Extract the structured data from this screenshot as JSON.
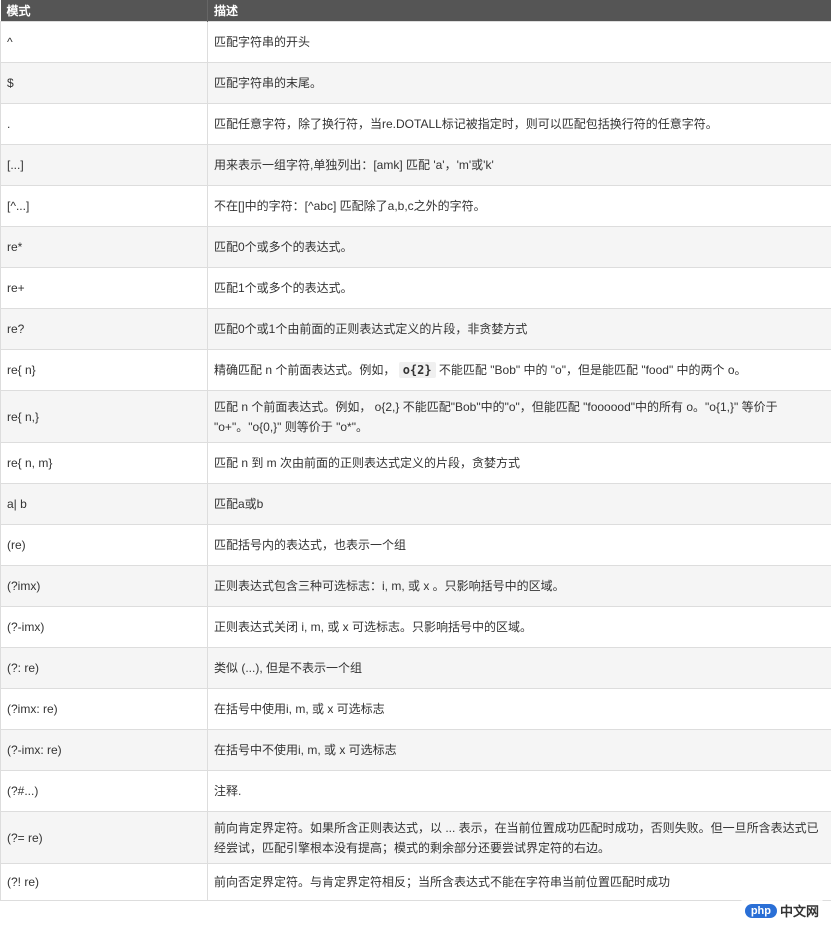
{
  "table": {
    "headers": [
      "模式",
      "描述"
    ],
    "rows": [
      {
        "pattern": "^",
        "desc": "匹配字符串的开头"
      },
      {
        "pattern": "$",
        "desc": "匹配字符串的末尾。"
      },
      {
        "pattern": ".",
        "desc": "匹配任意字符，除了换行符，当re.DOTALL标记被指定时，则可以匹配包括换行符的任意字符。"
      },
      {
        "pattern": "[...]",
        "desc": "用来表示一组字符,单独列出：[amk] 匹配 'a'，'m'或'k'"
      },
      {
        "pattern": "[^...]",
        "desc": "不在[]中的字符：[^abc] 匹配除了a,b,c之外的字符。"
      },
      {
        "pattern": "re*",
        "desc": "匹配0个或多个的表达式。"
      },
      {
        "pattern": "re+",
        "desc": "匹配1个或多个的表达式。"
      },
      {
        "pattern": "re?",
        "desc": "匹配0个或1个由前面的正则表达式定义的片段，非贪婪方式"
      },
      {
        "pattern": "re{ n}",
        "desc_pre": "精确匹配 n 个前面表达式。例如， ",
        "desc_code": "o{2}",
        "desc_post": " 不能匹配 \"Bob\" 中的 \"o\"，但是能匹配 \"food\" 中的两个 o。"
      },
      {
        "pattern": "re{ n,}",
        "desc": "匹配 n 个前面表达式。例如， o{2,} 不能匹配\"Bob\"中的\"o\"，但能匹配 \"foooood\"中的所有 o。\"o{1,}\" 等价于 \"o+\"。\"o{0,}\" 则等价于 \"o*\"。"
      },
      {
        "pattern": "re{ n, m}",
        "desc": "匹配 n 到 m 次由前面的正则表达式定义的片段，贪婪方式"
      },
      {
        "pattern": "a| b",
        "desc": "匹配a或b"
      },
      {
        "pattern": "(re)",
        "desc": "匹配括号内的表达式，也表示一个组"
      },
      {
        "pattern": "(?imx)",
        "desc": "正则表达式包含三种可选标志：i, m, 或 x 。只影响括号中的区域。"
      },
      {
        "pattern": "(?-imx)",
        "desc": "正则表达式关闭 i, m, 或 x 可选标志。只影响括号中的区域。"
      },
      {
        "pattern": "(?: re)",
        "desc": "类似 (...), 但是不表示一个组"
      },
      {
        "pattern": "(?imx: re)",
        "desc": "在括号中使用i, m, 或 x 可选标志"
      },
      {
        "pattern": "(?-imx: re)",
        "desc": "在括号中不使用i, m, 或 x 可选标志"
      },
      {
        "pattern": "(?#...)",
        "desc": "注释."
      },
      {
        "pattern": "(?= re)",
        "desc": "前向肯定界定符。如果所含正则表达式，以 ... 表示，在当前位置成功匹配时成功，否则失败。但一旦所含表达式已经尝试，匹配引擎根本没有提高；模式的剩余部分还要尝试界定符的右边。"
      },
      {
        "pattern": "(?! re)",
        "desc": "前向否定界定符。与肯定界定符相反；当所含表达式不能在字符串当前位置匹配时成功"
      }
    ]
  },
  "watermark": {
    "logo": "php",
    "text": "中文网"
  }
}
